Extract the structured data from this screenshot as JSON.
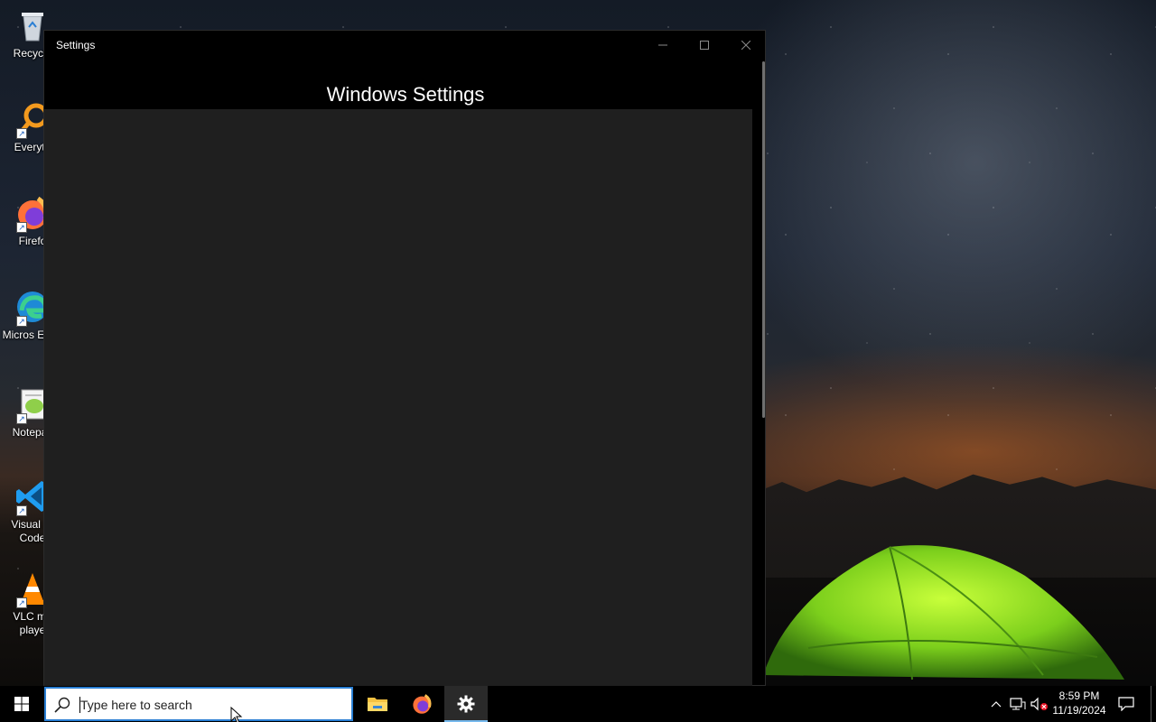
{
  "desktop": {
    "icons": [
      {
        "label": "Recycle",
        "icon": "recycle-bin-icon"
      },
      {
        "label": "Everyth",
        "icon": "everything-search-icon"
      },
      {
        "label": "Firefo",
        "icon": "firefox-icon"
      },
      {
        "label": "Micros Edge",
        "icon": "edge-icon"
      },
      {
        "label": "Notepac",
        "icon": "notepadpp-icon"
      },
      {
        "label": "Visual St Code",
        "icon": "vscode-icon"
      },
      {
        "label": "VLC me playe",
        "icon": "vlc-icon"
      }
    ]
  },
  "window": {
    "title": "Settings",
    "heading": "Windows Settings",
    "controls": {
      "minimize": "minimize-icon",
      "maximize": "maximize-icon",
      "close": "close-icon"
    }
  },
  "taskbar": {
    "search_placeholder": "Type here to search",
    "apps": [
      "file-explorer-icon",
      "firefox-icon",
      "settings-gear-icon"
    ],
    "active_app": "settings-gear-icon",
    "clock": {
      "time": "8:59 PM",
      "date": "11/19/2024"
    }
  },
  "colors": {
    "window_bg": "#000000",
    "content_bg": "#1f1f1f",
    "accent": "#2a7fd4",
    "active_underline": "#76b9ed"
  }
}
